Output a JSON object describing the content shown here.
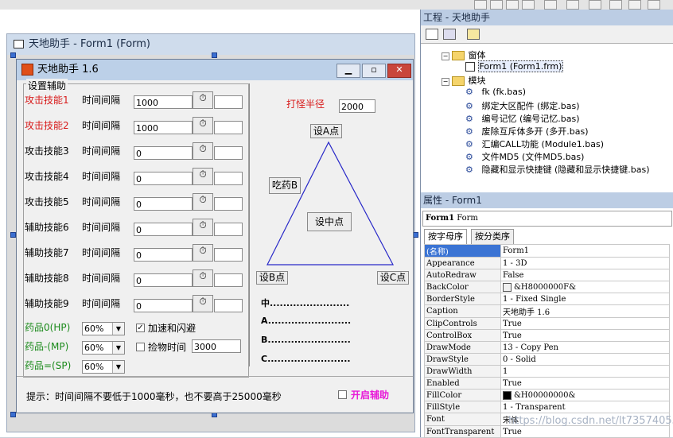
{
  "outer_form": {
    "title": "天地助手 - Form1 (Form)"
  },
  "app": {
    "title": "天地助手 1.6",
    "group_title": "设置辅助",
    "interval_label": "时间间隔",
    "skills": [
      {
        "name": "攻击技能1",
        "interval": "1000",
        "color": "#d81b1b"
      },
      {
        "name": "攻击技能2",
        "interval": "1000",
        "color": "#d81b1b"
      },
      {
        "name": "攻击技能3",
        "interval": "0",
        "color": "#000000"
      },
      {
        "name": "攻击技能4",
        "interval": "0",
        "color": "#000000"
      },
      {
        "name": "攻击技能5",
        "interval": "0",
        "color": "#000000"
      },
      {
        "name": "辅助技能6",
        "interval": "0",
        "color": "#000000"
      },
      {
        "name": "辅助技能7",
        "interval": "0",
        "color": "#000000"
      },
      {
        "name": "辅助技能8",
        "interval": "0",
        "color": "#000000"
      },
      {
        "name": "辅助技能9",
        "interval": "0",
        "color": "#000000"
      }
    ],
    "potions": [
      {
        "name": "药品0(HP)",
        "value": "60%"
      },
      {
        "name": "药品-(MP)",
        "value": "60%"
      },
      {
        "name": "药品=(SP)",
        "value": "60%"
      }
    ],
    "heal_dodge_label": "加速和闪避",
    "heal_dodge_checked": true,
    "pickup_label": "捡物时间",
    "pickup_time": "3000",
    "monster_radius_label": "打怪半径",
    "monster_radius": "2000",
    "set_a": "设A点",
    "set_b": "设B点",
    "set_c": "设C点",
    "set_center": "设中点",
    "eat_potion_b": "吃药B",
    "coords": [
      {
        "label": "中",
        "dots": "........................"
      },
      {
        "label": "A",
        "dots": "........................."
      },
      {
        "label": "B",
        "dots": "........................."
      },
      {
        "label": "C",
        "dots": "........................."
      }
    ],
    "hint": "提示：时间间隔不要低于1000毫秒，也不要高于25000毫秒",
    "start_label": "开启辅助",
    "start_color": "#e81ad8"
  },
  "project": {
    "title": "工程 - 天地助手",
    "tree": [
      {
        "label": "窗体",
        "level": 1,
        "icon": "folder-icon",
        "expanded": true
      },
      {
        "label": "Form1 (Form1.frm)",
        "level": 2,
        "icon": "form-icon",
        "selected": true
      },
      {
        "label": "模块",
        "level": 1,
        "icon": "folder-icon",
        "expanded": true
      },
      {
        "label": "fk (fk.bas)",
        "level": 2,
        "icon": "module-icon"
      },
      {
        "label": "绑定大区配件 (绑定.bas)",
        "level": 2,
        "icon": "module-icon"
      },
      {
        "label": "编号记忆 (编号记忆.bas)",
        "level": 2,
        "icon": "module-icon"
      },
      {
        "label": "废除互斥体多开 (多开.bas)",
        "level": 2,
        "icon": "module-icon"
      },
      {
        "label": "汇编CALL功能 (Module1.bas)",
        "level": 2,
        "icon": "module-icon"
      },
      {
        "label": "文件MD5 (文件MD5.bas)",
        "level": 2,
        "icon": "module-icon"
      },
      {
        "label": "隐藏和显示快捷键 (隐藏和显示快捷键.bas)",
        "level": 2,
        "icon": "module-icon"
      }
    ]
  },
  "properties": {
    "title": "属性 - Form1",
    "object": "Form1",
    "object_type": "Form",
    "tab_alpha": "按字母序",
    "tab_category": "按分类序",
    "rows": [
      {
        "key": "(名称)",
        "value": "Form1"
      },
      {
        "key": "Appearance",
        "value": "1 - 3D"
      },
      {
        "key": "AutoRedraw",
        "value": "False"
      },
      {
        "key": "BackColor",
        "value": "&H8000000F&",
        "swatch": "#f0f0f0"
      },
      {
        "key": "BorderStyle",
        "value": "1 - Fixed Single"
      },
      {
        "key": "Caption",
        "value": "天地助手 1.6"
      },
      {
        "key": "ClipControls",
        "value": "True"
      },
      {
        "key": "ControlBox",
        "value": "True"
      },
      {
        "key": "DrawMode",
        "value": "13 - Copy Pen"
      },
      {
        "key": "DrawStyle",
        "value": "0 - Solid"
      },
      {
        "key": "DrawWidth",
        "value": "1"
      },
      {
        "key": "Enabled",
        "value": "True"
      },
      {
        "key": "FillColor",
        "value": "&H00000000&",
        "swatch": "#000000"
      },
      {
        "key": "FillStyle",
        "value": "1 - Transparent"
      },
      {
        "key": "Font",
        "value": "宋体"
      },
      {
        "key": "FontTransparent",
        "value": "True"
      }
    ]
  },
  "watermark": "https://blog.csdn.net/lt735740559"
}
